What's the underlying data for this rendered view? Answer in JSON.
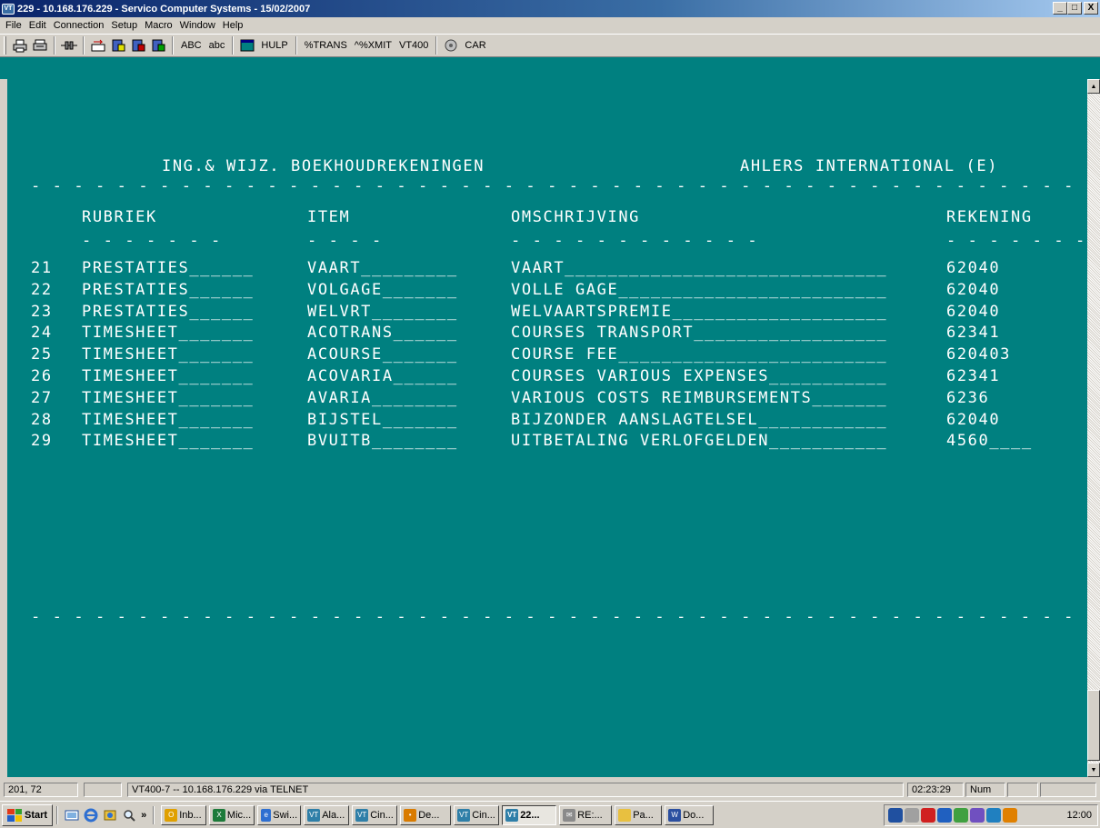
{
  "window": {
    "title": "229 - 10.168.176.229 - Servico Computer Systems - 15/02/2007",
    "icon_label": "VT",
    "minimize_label": "_",
    "maximize_label": "□",
    "close_label": "X"
  },
  "menu": [
    "File",
    "Edit",
    "Connection",
    "Setup",
    "Macro",
    "Window",
    "Help"
  ],
  "toolbar": {
    "icons": [
      "print-icon",
      "print-setup-icon",
      "connect-icon",
      "send-file-icon",
      "receive-file-icon",
      "transfer-icon",
      "capture-icon"
    ],
    "abc_upper": "ABC",
    "abc_lower": "abc",
    "hulp": "HULP",
    "trans": "%TRANS",
    "xmit": "^%XMIT",
    "vt400": "VT400",
    "car": "CAR"
  },
  "terminal": {
    "screen_title": "ING.& WIJZ. BOEKHOUDREKENINGEN",
    "company": "AHLERS INTERNATIONAL (E)",
    "divider": "- - - - - - - - - - - - - - - - - - - - - - - - - - - - - - - - - - - - - - - - - - - - - - - - - - - - - - - - - - - - - - - - - -",
    "headers": {
      "rubriek": "RUBRIEK",
      "item": "ITEM",
      "omschrijving": "OMSCHRIJVING",
      "rekening": "REKENING"
    },
    "underlines": {
      "rubriek": "- - - - - - -",
      "item": "- - - -",
      "omschrijving": "- - - - - - - - - - - -",
      "rekening": "- - - - - - - -"
    },
    "rows": [
      {
        "nr": "21",
        "rubriek": "PRESTATIES______",
        "item": "VAART_________",
        "omschrijving": "VAART______________________________",
        "rekening": "62040"
      },
      {
        "nr": "22",
        "rubriek": "PRESTATIES______",
        "item": "VOLGAGE_______",
        "omschrijving": "VOLLE GAGE_________________________",
        "rekening": "62040"
      },
      {
        "nr": "23",
        "rubriek": "PRESTATIES______",
        "item": "WELVRT________",
        "omschrijving": "WELVAARTSPREMIE____________________",
        "rekening": "62040"
      },
      {
        "nr": "24",
        "rubriek": "TIMESHEET_______",
        "item": "ACOTRANS______",
        "omschrijving": "COURSES TRANSPORT__________________",
        "rekening": "62341"
      },
      {
        "nr": "25",
        "rubriek": "TIMESHEET_______",
        "item": "ACOURSE_______",
        "omschrijving": "COURSE FEE_________________________",
        "rekening": "620403"
      },
      {
        "nr": "26",
        "rubriek": "TIMESHEET_______",
        "item": "ACOVARIA______",
        "omschrijving": "COURSES VARIOUS EXPENSES___________",
        "rekening": "62341"
      },
      {
        "nr": "27",
        "rubriek": "TIMESHEET_______",
        "item": "AVARIA________",
        "omschrijving": "VARIOUS COSTS REIMBURSEMENTS_______",
        "rekening": "6236"
      },
      {
        "nr": "28",
        "rubriek": "TIMESHEET_______",
        "item": "BIJSTEL_______",
        "omschrijving": "BIJZONDER AANSLAGTELSEL____________",
        "rekening": "62040"
      },
      {
        "nr": "29",
        "rubriek": "TIMESHEET_______",
        "item": "BVUITB________",
        "omschrijving": "UITBETALING VERLOFGELDEN___________",
        "rekening": "4560____"
      }
    ]
  },
  "status": {
    "cursor": "201, 72",
    "connection": "VT400-7 -- 10.168.176.229 via TELNET",
    "time": "02:23:29",
    "num": "Num"
  },
  "taskbar": {
    "start": "Start",
    "chevron": "»",
    "buttons": [
      {
        "label": "Inb...",
        "icon": "outlook-icon",
        "color": "#e0a000",
        "glyph": "O"
      },
      {
        "label": "Mic...",
        "icon": "excel-icon",
        "color": "#1d7a3a",
        "glyph": "X"
      },
      {
        "label": "Swi...",
        "icon": "ie-icon",
        "color": "#2e6fd1",
        "glyph": "e"
      },
      {
        "label": "Ala...",
        "icon": "vt-icon",
        "color": "#2f7fa8",
        "glyph": "VT"
      },
      {
        "label": "Cin...",
        "icon": "vt-icon",
        "color": "#2f7fa8",
        "glyph": "VT"
      },
      {
        "label": "De...",
        "icon": "messenger-icon",
        "color": "#d97b00",
        "glyph": "•"
      },
      {
        "label": "Cin...",
        "icon": "vt-icon",
        "color": "#2f7fa8",
        "glyph": "VT"
      },
      {
        "label": "22...",
        "icon": "vt-icon",
        "color": "#2f7fa8",
        "glyph": "VT"
      },
      {
        "label": "RE:...",
        "icon": "mail-icon",
        "color": "#8a8a8a",
        "glyph": "✉"
      },
      {
        "label": "Pa...",
        "icon": "folder-icon",
        "color": "#e8c040",
        "glyph": ""
      },
      {
        "label": "Do...",
        "icon": "word-icon",
        "color": "#2b4fa0",
        "glyph": "W"
      }
    ],
    "clock": "12:00"
  },
  "colors": {
    "terminal_bg": "#008080",
    "terminal_fg": "#ffffff",
    "chrome": "#d4d0c8",
    "titlebar": "#0a246a"
  }
}
